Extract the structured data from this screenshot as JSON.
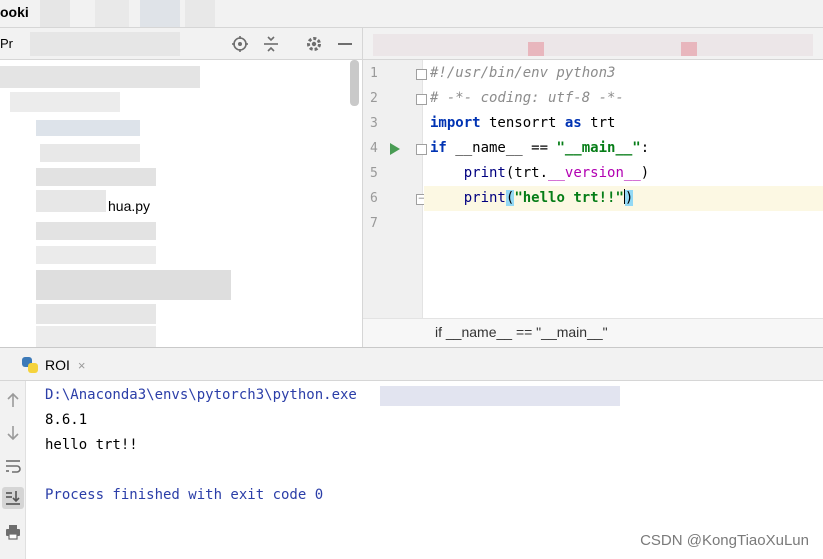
{
  "window": {
    "title": "ooki"
  },
  "project_panel": {
    "label": "Pr",
    "visible_file_fragment": "hua.py"
  },
  "editor": {
    "lines": [
      {
        "num": "1",
        "segments": [
          {
            "t": "#!/usr/bin/env python3",
            "c": "comment"
          }
        ]
      },
      {
        "num": "2",
        "segments": [
          {
            "t": "# -*- coding: utf-8 -*-",
            "c": "comment"
          }
        ]
      },
      {
        "num": "3",
        "segments": [
          {
            "t": "import",
            "c": "kw"
          },
          {
            "t": " tensorrt ",
            "c": "plain"
          },
          {
            "t": "as",
            "c": "kw"
          },
          {
            "t": " trt",
            "c": "plain"
          }
        ]
      },
      {
        "num": "4",
        "segments": [
          {
            "t": "if",
            "c": "kw"
          },
          {
            "t": " __name__ == ",
            "c": "plain"
          },
          {
            "t": "\"__main__\"",
            "c": "str"
          },
          {
            "t": ":",
            "c": "plain"
          }
        ]
      },
      {
        "num": "5",
        "segments": [
          {
            "t": "    ",
            "c": "plain"
          },
          {
            "t": "print",
            "c": "builtin"
          },
          {
            "t": "(trt.",
            "c": "plain"
          },
          {
            "t": "__version__",
            "c": "dunder"
          },
          {
            "t": ")",
            "c": "plain"
          }
        ]
      },
      {
        "num": "6",
        "segments": [
          {
            "t": "    ",
            "c": "plain"
          },
          {
            "t": "print",
            "c": "builtin"
          },
          {
            "t": "(",
            "c": "brace"
          },
          {
            "t": "\"hello trt!!\"",
            "c": "str"
          },
          {
            "t": ")",
            "c": "brace"
          }
        ]
      },
      {
        "num": "7",
        "segments": []
      }
    ],
    "breadcrumb": "if __name__ == \"__main__\""
  },
  "run_window": {
    "tab_label": "ROI",
    "close_glyph": "×",
    "output": [
      {
        "text": "D:\\Anaconda3\\envs\\pytorch3\\python.exe",
        "style": "blue"
      },
      {
        "text": "8.6.1",
        "style": "black"
      },
      {
        "text": "hello trt!!",
        "style": "black"
      },
      {
        "text": "",
        "style": "black"
      },
      {
        "text": "Process finished with exit code 0",
        "style": "blue"
      }
    ]
  },
  "watermark": "CSDN @KongTiaoXuLun",
  "colors": {
    "keyword": "#0033b3",
    "string": "#067d17",
    "comment": "#8c8c8c",
    "dunder": "#b200b2",
    "console_blue": "#2b3ea8",
    "run_gutter_icon": "#499c54"
  },
  "icons": {
    "project_toolbar": [
      "crosshair-icon",
      "collapse-icon",
      "gear-icon",
      "minimize-icon"
    ],
    "run_side": [
      "arrow-up-icon",
      "arrow-down-icon",
      "soft-wrap-icon",
      "scroll-to-end-icon",
      "print-icon"
    ]
  }
}
